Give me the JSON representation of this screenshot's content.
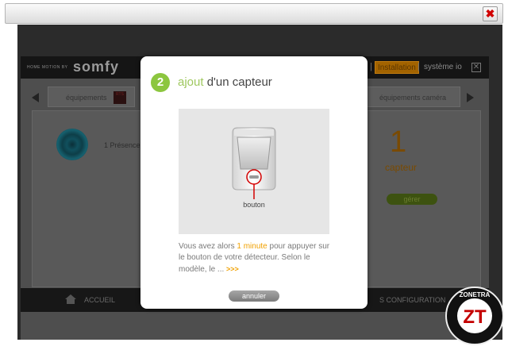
{
  "window": {
    "close_icon": "close-x-icon",
    "close_color": "#d10000"
  },
  "app": {
    "brand_small": "HOME MOTION BY",
    "brand_logo": "somfy",
    "tabs": {
      "installation": "Installation",
      "separator": "|",
      "systeme": "système io"
    },
    "categories": {
      "equipements": "équipements",
      "rts": "RTS",
      "cameras": "équipements caméra"
    },
    "presence": "1 Présence",
    "count": "1",
    "count_label": "capteur",
    "gerer": "gérer",
    "bottom": {
      "accueil": "ACCUEIL",
      "config": "S   CONFIGURATION"
    }
  },
  "modal": {
    "step": "2",
    "title_pre": "ajout",
    "title_rest": " d'un capteur",
    "illustration_label": "bouton",
    "instr_1": "Vous avez alors ",
    "instr_highlight": "1 minute",
    "instr_2": " pour appuyer sur le bouton de votre détecteur. Selon le modèle, le ",
    "instr_ellipsis": "...",
    "instr_more": ">>>",
    "cancel": "annuler",
    "accent": "#8cc63f",
    "highlight_color": "#f0a000"
  },
  "watermark": {
    "line1": "ZONETRA",
    "logo": "ZT"
  }
}
